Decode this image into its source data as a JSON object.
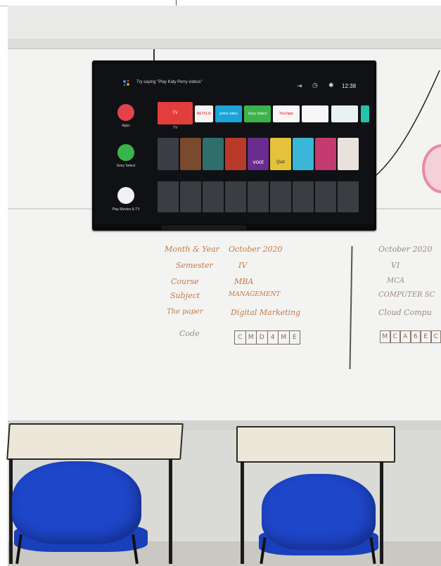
{
  "tv": {
    "assistant_hint": "Try saying \"Play Katy Perry videos\"",
    "time": "12:38",
    "sidebar": [
      {
        "label": "Apps",
        "icon": "apps-grid-icon"
      },
      {
        "label": "Sony Select",
        "icon": "sony-select-icon"
      },
      {
        "label": "Play Movies & TV",
        "icon": "play-movies-icon"
      }
    ],
    "channels": {
      "tv": "TV",
      "tv_caption": "TV",
      "items": [
        "NETFLIX",
        "prime video",
        "Sony Select",
        "YouTube",
        "",
        "",
        ""
      ]
    },
    "poster_texts": [
      "voot",
      "Quiz"
    ],
    "status_icons": [
      "input-icon",
      "clock-icon",
      "gear-icon"
    ]
  },
  "whiteboard": {
    "lines_left": [
      {
        "label": "Month & Year",
        "value": "October 2020"
      },
      {
        "label": "Semester",
        "value": "IV"
      },
      {
        "label": "Course",
        "value": "MBA"
      },
      {
        "label": "Subject",
        "value": "MANAGEMENT"
      },
      {
        "label": "The paper",
        "value": "Digital Marketing"
      },
      {
        "label": "Code",
        "value": ""
      }
    ],
    "code_left": [
      "C",
      "M",
      "D",
      "4",
      "M",
      "E"
    ],
    "lines_right": [
      "October 2020",
      "VI",
      "MCA",
      "COMPUTER SC",
      "Cloud Compu"
    ],
    "code_right": [
      "M",
      "C",
      "A",
      "6",
      "E",
      "C"
    ]
  },
  "colors": {
    "chair": "#1e46c9",
    "marker": "#c27a45",
    "tv_red": "#e23e3e"
  }
}
